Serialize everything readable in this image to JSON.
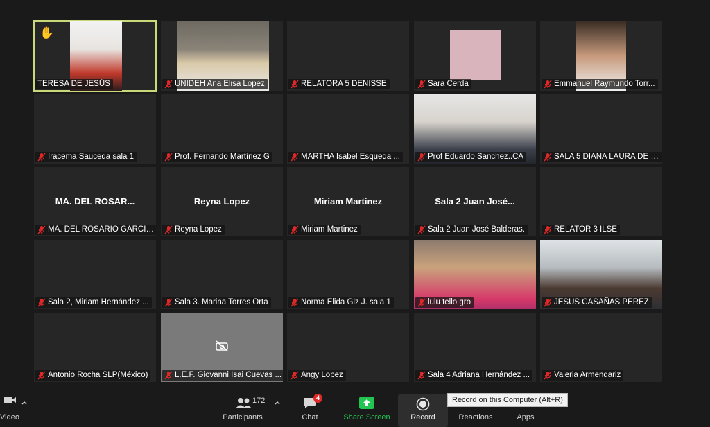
{
  "participants": [
    {
      "name": "TERESA DE JESÚS",
      "muted": false,
      "video": "photo",
      "hand": true,
      "active": true
    },
    {
      "name": "UNIDEH Ana Elisa Lopez",
      "muted": true,
      "video": "photo"
    },
    {
      "name": "RELATORA 5 DENISSE",
      "muted": true,
      "video": "none"
    },
    {
      "name": "Sara Cerda",
      "muted": true,
      "video": "avatar"
    },
    {
      "name": "Emmanuel Raymundo Torr...",
      "muted": true,
      "video": "photo"
    },
    {
      "name": "Iracema Sauceda sala 1",
      "muted": true,
      "video": "none"
    },
    {
      "name": "Prof. Fernando Martínez G",
      "muted": true,
      "video": "none"
    },
    {
      "name": "MARTHA Isabel Esqueda ...",
      "muted": true,
      "video": "none"
    },
    {
      "name": "Prof Eduardo Sanchez..CA",
      "muted": true,
      "video": "photo"
    },
    {
      "name": "SALA 5 DIANA LAURA DE L...",
      "muted": true,
      "video": "none"
    },
    {
      "name": "MA. DEL ROSARIO GARCIA...",
      "muted": true,
      "video": "none",
      "display_name": "MA. DEL ROSAR..."
    },
    {
      "name": "Reyna Lopez",
      "muted": true,
      "video": "none",
      "display_name": "Reyna Lopez"
    },
    {
      "name": "Miriam Martinez",
      "muted": true,
      "video": "none",
      "display_name": "Miriam Martinez"
    },
    {
      "name": "Sala 2 Juan José Balderas.",
      "muted": true,
      "video": "none",
      "display_name": "Sala 2 Juan José..."
    },
    {
      "name": "RELATOR 3 ILSE",
      "muted": true,
      "video": "none"
    },
    {
      "name": "Sala 2, Miriam Hernández ...",
      "muted": true,
      "video": "none"
    },
    {
      "name": "Sala 3. Marina Torres Orta",
      "muted": true,
      "video": "none"
    },
    {
      "name": "Norma Elida Glz J. sala 1",
      "muted": true,
      "video": "none"
    },
    {
      "name": "lulu tello gro",
      "muted": true,
      "video": "photo"
    },
    {
      "name": "JESUS CASAÑAS PEREZ",
      "muted": true,
      "video": "photo"
    },
    {
      "name": "Antonio Rocha SLP(México)",
      "muted": true,
      "video": "none"
    },
    {
      "name": "L.E.F. Giovanni Isai Cuevas ...",
      "muted": true,
      "video": "off"
    },
    {
      "name": "Angy Lopez",
      "muted": true,
      "video": "none"
    },
    {
      "name": "Sala 4 Adriana Hernández ...",
      "muted": true,
      "video": "none"
    },
    {
      "name": "Valeria Armendariz",
      "muted": true,
      "video": "none"
    }
  ],
  "toolbar": {
    "video_label": "Video",
    "participants_label": "Participants",
    "participants_count": "172",
    "chat_label": "Chat",
    "chat_badge": "4",
    "share_label": "Share Screen",
    "record_label": "Record",
    "reactions_label": "Reactions",
    "apps_label": "Apps",
    "record_tooltip": "Record on this Computer (Alt+R)"
  },
  "colors": {
    "accent_green": "#23c552",
    "active_border": "#c9d97a",
    "muted_red": "#e02828"
  }
}
